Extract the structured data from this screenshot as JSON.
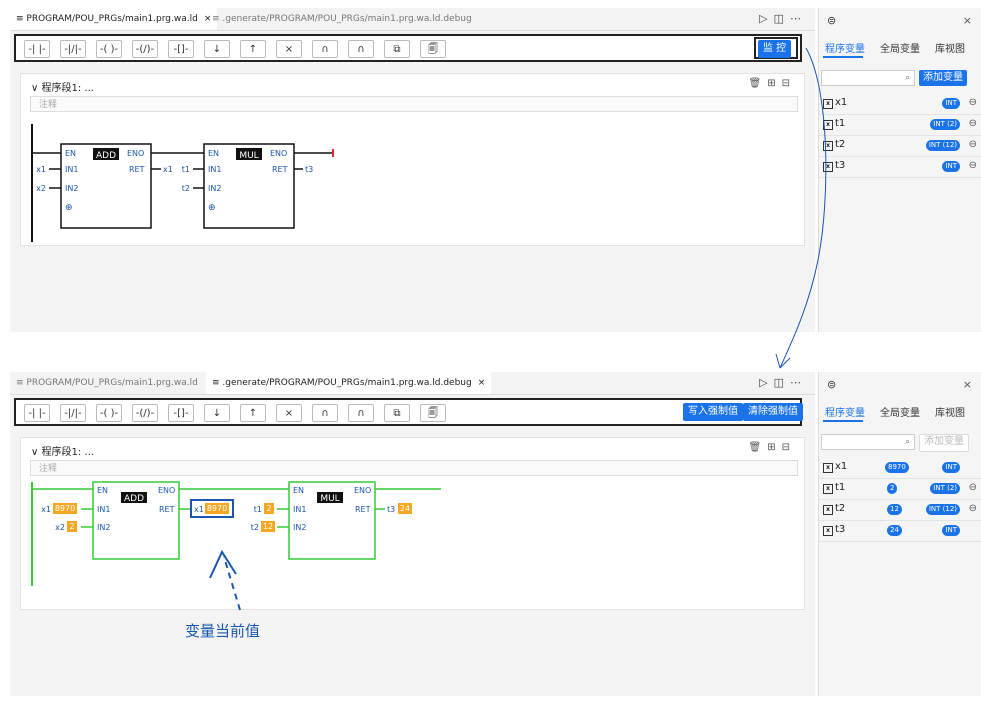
{
  "top": {
    "tab_active": "PROGRAM/POU_PRGs/main1.prg.wa.ld",
    "tab_inactive": ".generate/PROGRAM/POU_PRGs/main1.prg.wa.ld.debug",
    "monitor_button": "监 控",
    "section_title": "程序段1: ...",
    "comment_placeholder": "注释"
  },
  "bottom": {
    "tab_inactive": "PROGRAM/POU_PRGs/main1.prg.wa.ld",
    "tab_active": ".generate/PROGRAM/POU_PRGs/main1.prg.wa.ld.debug",
    "write_force_button": "写入强制值",
    "clear_force_button": "清除强制值",
    "section_title": "程序段1: ...",
    "comment_placeholder": "注释"
  },
  "tab_close": "×",
  "toolbar_buttons": [
    "-| |-",
    "-|/|-",
    "-( )-",
    "-(/)-",
    "-[]-",
    "↓",
    "↑",
    "×",
    "∩",
    "∩",
    "⧉",
    "🗐"
  ],
  "sidebar": {
    "tabs": [
      "程序变量",
      "全局变量",
      "库视图"
    ],
    "add_button": "添加变量",
    "vars_top": [
      {
        "name": "x1",
        "type": "INT"
      },
      {
        "name": "t1",
        "type": "INT (2)"
      },
      {
        "name": "t2",
        "type": "INT (12)"
      },
      {
        "name": "t3",
        "type": "INT"
      }
    ],
    "vars_bottom": [
      {
        "name": "x1",
        "value": "8970",
        "type": "INT"
      },
      {
        "name": "t1",
        "value": "2",
        "type": "INT (2)"
      },
      {
        "name": "t2",
        "value": "12",
        "type": "INT (12)"
      },
      {
        "name": "t3",
        "value": "24",
        "type": "INT"
      }
    ]
  },
  "ld_top": {
    "add": {
      "title": "ADD",
      "en": "EN",
      "eno": "ENO",
      "in1": "IN1",
      "in2": "IN2",
      "ret": "RET"
    },
    "mul": {
      "title": "MUL",
      "en": "EN",
      "eno": "ENO",
      "in1": "IN1",
      "in2": "IN2",
      "ret": "RET"
    },
    "add_in1_var": "x1",
    "add_in2_var": "x2",
    "add_ret_var": "x1",
    "mul_in1_var": "t1",
    "mul_in2_var": "t2",
    "mul_ret_var": "t3",
    "add_pin_symbol": "⊕"
  },
  "ld_bottom": {
    "add_in1_var": "x1",
    "add_in1_val": "8970",
    "add_in2_var": "x2",
    "add_in2_val": "2",
    "add_ret_var": "x1",
    "add_ret_val": "8970",
    "mul_in1_var": "t1",
    "mul_in1_val": "2",
    "mul_in2_var": "t2",
    "mul_in2_val": "12",
    "mul_ret_var": "t3",
    "mul_ret_val": "24"
  },
  "annotation": "变量当前值",
  "colors": {
    "accent": "#1a73e8",
    "power_flow": "#33cc33",
    "value_bg": "#f5a623",
    "coil": "#d32f2f"
  }
}
